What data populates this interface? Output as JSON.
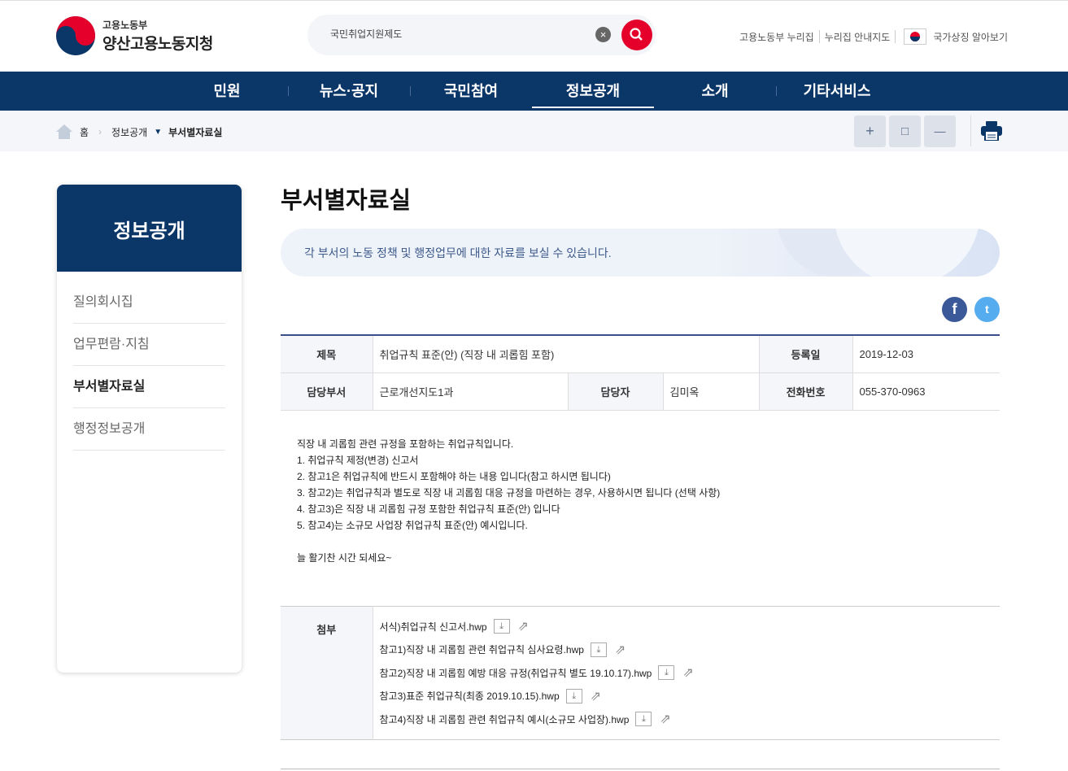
{
  "header": {
    "org_sub": "고용노동부",
    "org_main": "양산고용노동지청",
    "search_value": "국민취업지원제도",
    "util": [
      "고용노동부 누리집",
      "누리집 안내지도",
      "국가상징 알아보기"
    ]
  },
  "nav": [
    "민원",
    "뉴스·공지",
    "국민참여",
    "정보공개",
    "소개",
    "기타서비스"
  ],
  "breadcrumb": {
    "home": "홈",
    "section": "정보공개",
    "current": "부서별자료실"
  },
  "toolbar": {
    "zoom_in": "+",
    "reset": "□",
    "zoom_out": "—"
  },
  "sidebar": {
    "title": "정보공개",
    "items": [
      "질의회시집",
      "업무편람·지침",
      "부서별자료실",
      "행정정보공개"
    ]
  },
  "page": {
    "title": "부서별자료실",
    "banner": "각 부서의 노동 정책 및 행정업무에 대한 자료를 보실 수 있습니다."
  },
  "info": {
    "title_label": "제목",
    "title": "취업규칙 표준(안) (직장 내 괴롭힘 포함)",
    "date_label": "등록일",
    "date": "2019-12-03",
    "dept_label": "담당부서",
    "dept": "근로개선지도1과",
    "person_label": "담당자",
    "person": "김미옥",
    "phone_label": "전화번호",
    "phone": "055-370-0963"
  },
  "body": [
    "직장 내 괴롭힘  관련 규정을 포함하는 취업규칙입니다.",
    "1. 취업규칙 제정(변경) 신고서",
    "2. 참고1은  취업규칙에 반드시 포함해야 하는 내용 입니다(참고 하시면 됩니다)",
    "3. 참고2)는 취업규칙과 별도로  직장 내 괴롭힘 대응 규정을 마련하는 경우,  사용하시면 됩니다 (선택 사항)",
    "4. 참고3)은 직장 내 괴롭힘 규정 포함한 취업규칙 표준(안) 입니다",
    "5. 참고4)는 소규모 사업장 취업규칙 표준(안) 예시입니다.",
    "",
    "늘 활기찬 시간 되세요~"
  ],
  "attachments": {
    "label": "첨부",
    "files": [
      "서식)취업규칙 신고서.hwp",
      "참고1)직장 내 괴롭힘 관련 취업규칙 심사요령.hwp",
      "참고2)직장 내 괴롭힘 예방 대응 규정(취업규칙 별도 19.10.17).hwp",
      "참고3)표준 취업규칙(최종 2019.10.15).hwp",
      "참고4)직장 내 괴롭힘 관련 취업규칙 예시(소규모 사업장).hwp"
    ]
  }
}
